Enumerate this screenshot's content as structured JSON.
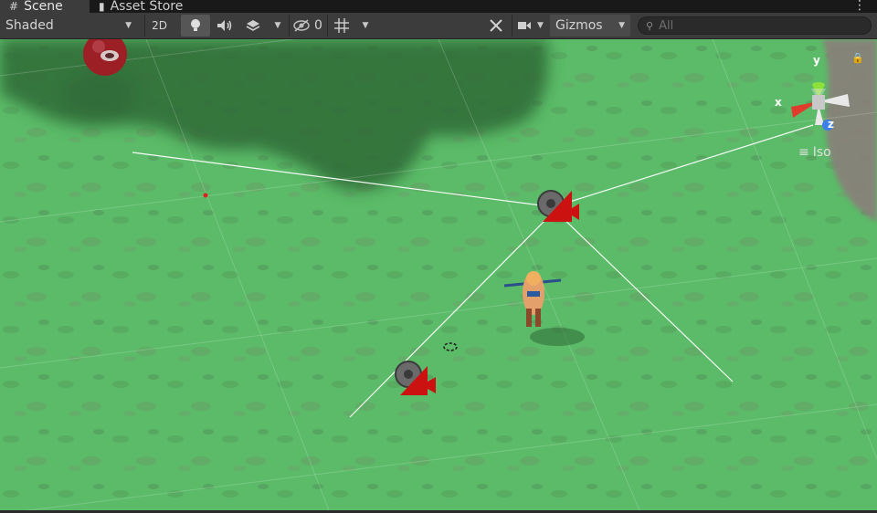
{
  "tabs": [
    {
      "label": "Scene",
      "icon": "grid-icon"
    },
    {
      "label": "Asset Store",
      "icon": "shopping-bag-icon"
    }
  ],
  "toolbar": {
    "shading_mode": "Shaded",
    "mode_2d_label": "2D",
    "hidden_count": "0",
    "gizmos_label": "Gizmos",
    "search_placeholder": "All"
  },
  "orientation_gizmo": {
    "axis_x": "x",
    "axis_y": "y",
    "axis_z": "z",
    "projection_label": "Iso"
  },
  "colors": {
    "grass": "#58b865",
    "camera_gizmo": "#cc1111",
    "toolbar": "#3c3c3c",
    "axis_x": "#e03c2c",
    "axis_y": "#8ee03a",
    "axis_z": "#3c7fe8"
  }
}
